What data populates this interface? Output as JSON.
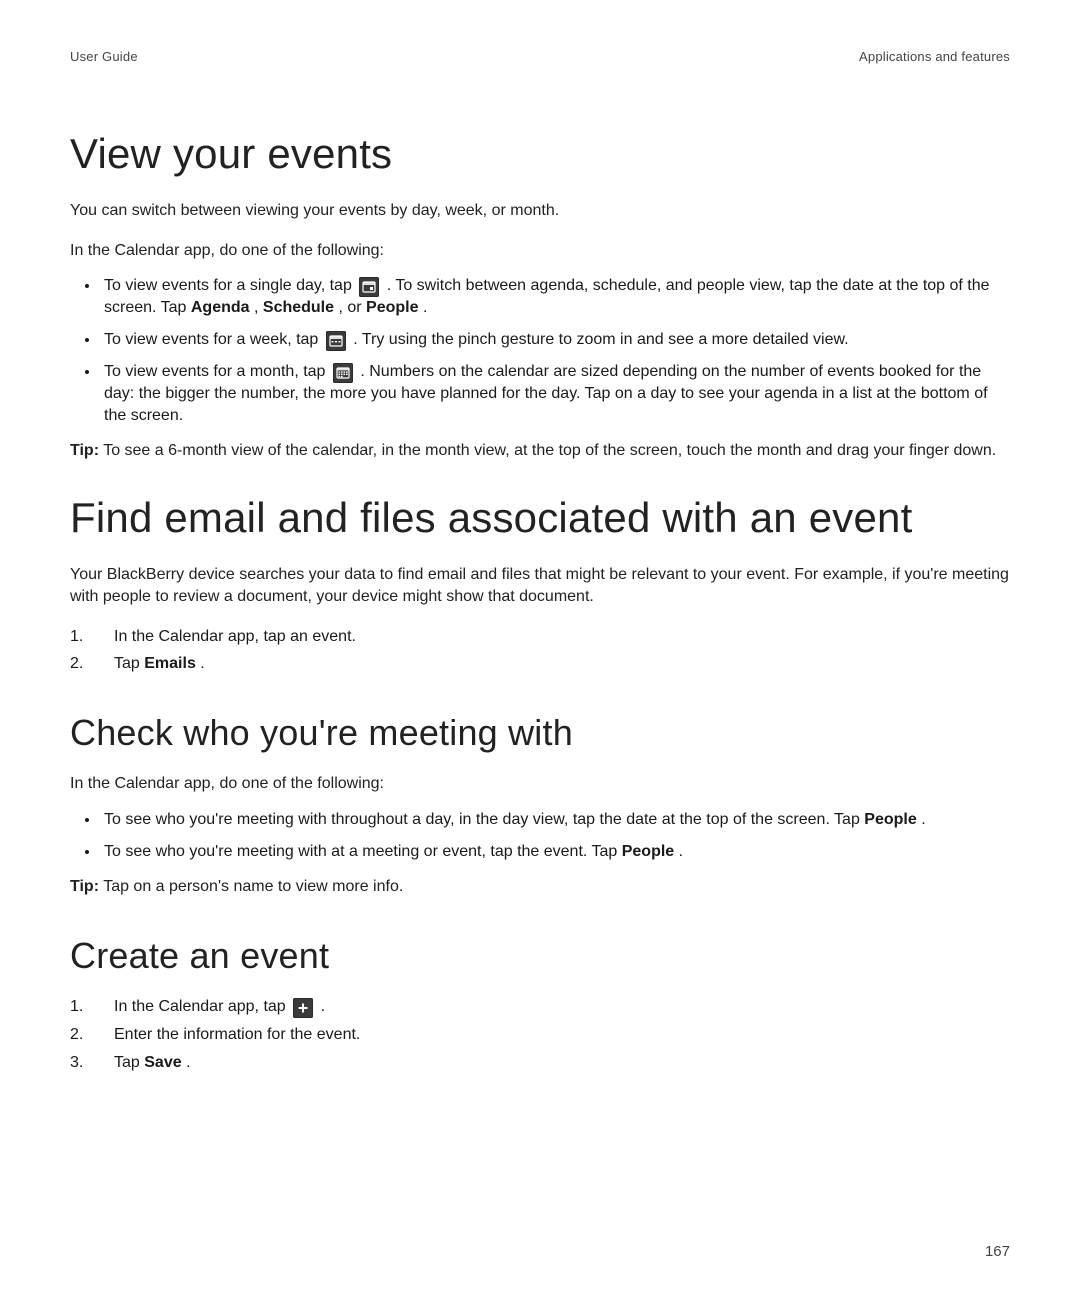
{
  "header": {
    "left": "User Guide",
    "right": "Applications and features"
  },
  "page_number": "167",
  "view_events": {
    "title": "View your events",
    "intro": "You can switch between viewing your events by day, week, or month.",
    "precondition": "In the Calendar app, do one of the following:",
    "bullets": [
      {
        "pre": "To view events for a single day, tap ",
        "icon": "day-icon",
        "post1": ". To switch between agenda, schedule, and people view, tap the date at the top of the screen. Tap ",
        "b1": "Agenda",
        "sep1": ", ",
        "b2": "Schedule",
        "sep2": ", or ",
        "b3": "People",
        "tail": "."
      },
      {
        "pre": "To view events for a week, tap ",
        "icon": "week-icon",
        "post": ". Try using the pinch gesture to zoom in and see a more detailed view."
      },
      {
        "pre": "To view events for a month, tap ",
        "icon": "month-icon",
        "post": ". Numbers on the calendar are sized depending on the number of events booked for the day: the bigger the number, the more you have planned for the day. Tap on a day to see your agenda in a list at the bottom of the screen."
      }
    ],
    "tip_label": "Tip:",
    "tip_text": " To see a 6-month view of the calendar, in the month view, at the top of the screen, touch the month and drag your finger down."
  },
  "find_email": {
    "title": "Find email and files associated with an event",
    "intro": "Your BlackBerry device searches your data to find email and files that might be relevant to your event. For example, if you're meeting with people to review a document, your device might show that document.",
    "steps": [
      {
        "text": "In the Calendar app, tap an event."
      },
      {
        "pre": "Tap ",
        "b": "Emails",
        "post": "."
      }
    ]
  },
  "check_who": {
    "title": "Check who you're meeting with",
    "precondition": "In the Calendar app, do one of the following:",
    "bullets": [
      {
        "pre": "To see who you're meeting with throughout a day, in the day view, tap the date at the top of the screen. Tap ",
        "b": "People",
        "post": "."
      },
      {
        "pre": "To see who you're meeting with at a meeting or event, tap the event. Tap ",
        "b": "People",
        "post": "."
      }
    ],
    "tip_label": "Tip:",
    "tip_text": " Tap on a person's name to view more info."
  },
  "create_event": {
    "title": "Create an event",
    "steps": [
      {
        "pre": "In the Calendar app, tap ",
        "icon": "plus-icon",
        "post": "."
      },
      {
        "text": "Enter the information for the event."
      },
      {
        "pre": "Tap ",
        "b": "Save",
        "post": "."
      }
    ]
  }
}
